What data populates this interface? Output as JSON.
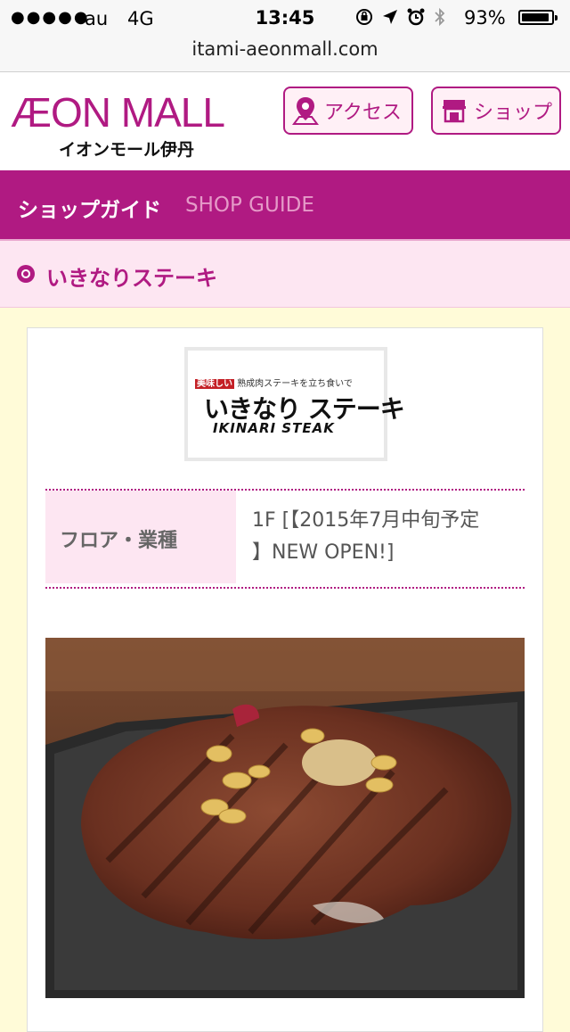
{
  "status_bar": {
    "signal": "●●●●●",
    "carrier": "au",
    "network": "4G",
    "time": "13:45",
    "battery_percent": "93%",
    "battery_level": 0.93
  },
  "url_bar": {
    "url": "itami-aeonmall.com"
  },
  "header": {
    "logo_main": "ÆON MALL",
    "logo_sub": "イオンモール伊丹",
    "access_label": "アクセス",
    "shop_label": "ショップ"
  },
  "guide": {
    "title_ja": "ショップガイド",
    "title_en": "SHOP GUIDE"
  },
  "shop": {
    "name": "いきなりステーキ",
    "logo_tagline_tag": "美味しい",
    "logo_tagline": "熟成肉ステーキを立ち食いで",
    "logo_text": "いきなり ステーキ",
    "logo_text_en": "IKINARI STEAK"
  },
  "info": {
    "floor_label": "フロア・業種",
    "floor_value_line1": "1F [【2015年7月中旬予定",
    "floor_value_line2": "】NEW OPEN!]"
  },
  "colors": {
    "brand": "#b01a82",
    "brand_light": "#fde6f2",
    "page_bg": "#fffbd8"
  }
}
